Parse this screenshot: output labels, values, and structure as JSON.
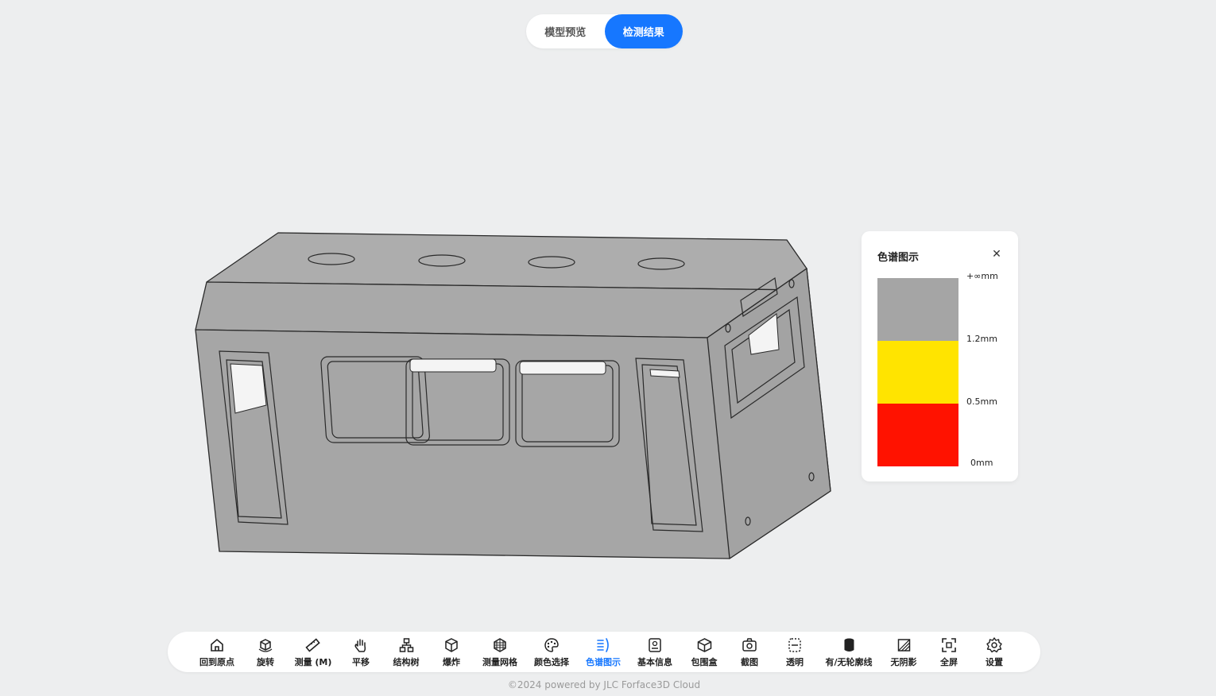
{
  "tabs": [
    {
      "label": "模型预览",
      "active": false
    },
    {
      "label": "检测结果",
      "active": true
    }
  ],
  "legend": {
    "title": "色谱图示",
    "close_icon": "close-icon",
    "bands": [
      {
        "color": "#a5a5a5",
        "top_label": "+∞mm"
      },
      {
        "color": "#ffe400",
        "top_label": "1.2mm"
      },
      {
        "color": "#ff1200",
        "top_label": "0.5mm"
      }
    ],
    "bottom_label": "0mm"
  },
  "model": {
    "color": "#a5a5a5",
    "edge_color": "#2a2a2a"
  },
  "toolbar": {
    "accent": "#1677ff",
    "items": [
      {
        "label": "回到原点",
        "icon": "home-icon"
      },
      {
        "label": "旋转",
        "icon": "rotate-cube-icon"
      },
      {
        "label": "测量 (M)",
        "icon": "ruler-icon"
      },
      {
        "label": "平移",
        "icon": "hand-icon"
      },
      {
        "label": "结构树",
        "icon": "tree-icon"
      },
      {
        "label": "爆炸",
        "icon": "explode-cube-icon"
      },
      {
        "label": "测量网格",
        "icon": "grid-sphere-icon"
      },
      {
        "label": "颜色选择",
        "icon": "palette-icon"
      },
      {
        "label": "色谱图示",
        "icon": "spectrum-icon",
        "active": true
      },
      {
        "label": "基本信息",
        "icon": "info-doc-icon"
      },
      {
        "label": "包围盒",
        "icon": "bounding-box-icon"
      },
      {
        "label": "截图",
        "icon": "camera-icon"
      },
      {
        "label": "透明",
        "icon": "transparent-icon"
      },
      {
        "label": "有/无轮廓线",
        "icon": "outline-cylinder-icon"
      },
      {
        "label": "无阴影",
        "icon": "no-shadow-icon"
      },
      {
        "label": "全屏",
        "icon": "fullscreen-icon"
      },
      {
        "label": "设置",
        "icon": "gear-icon"
      }
    ]
  },
  "footer": "©2024 powered by JLC Forface3D Cloud"
}
